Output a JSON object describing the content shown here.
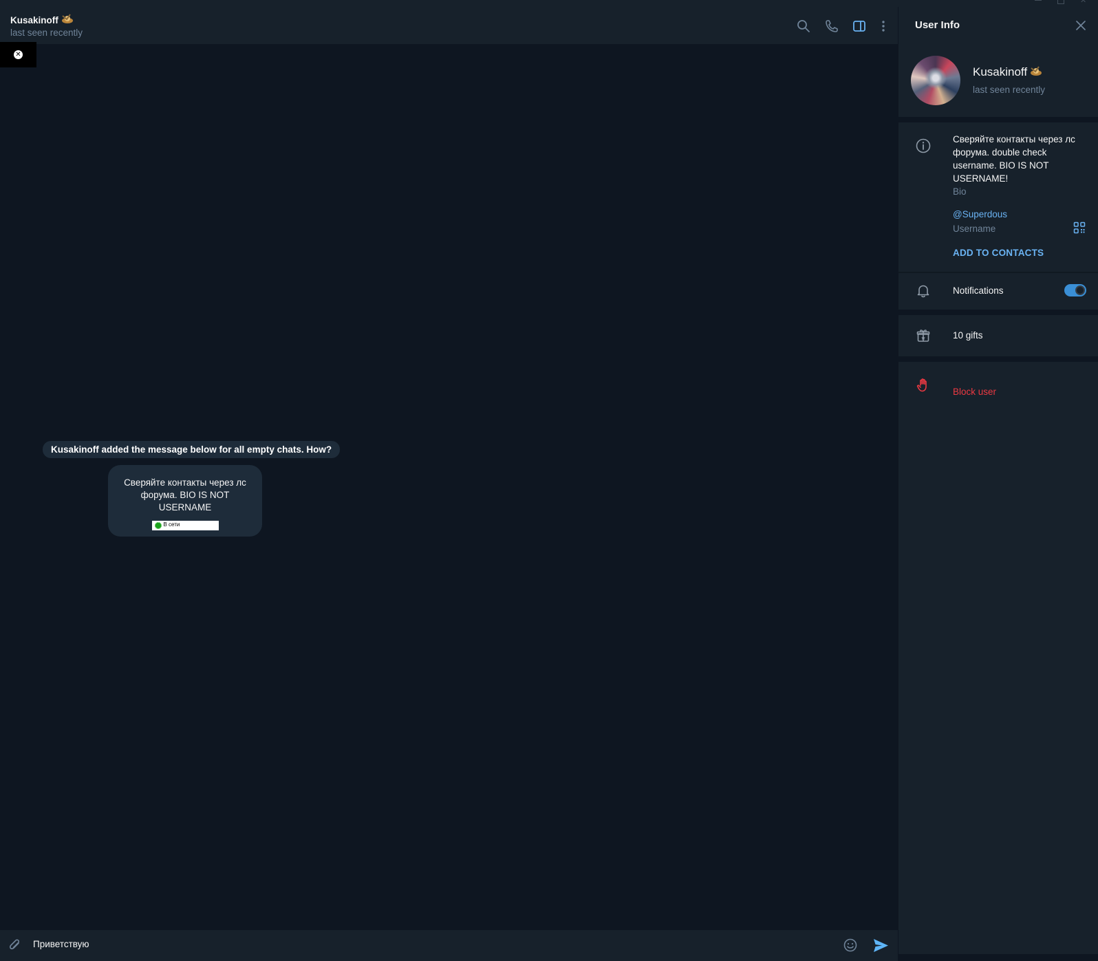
{
  "chat": {
    "title": "Kusakinoff",
    "status": "last seen recently",
    "service_message": "Kusakinoff added the message below for all empty chats. How?",
    "greeting": {
      "text": "Сверяйте контакты через лс форума. BIO IS NOT USERNAME",
      "badge_label": "В сети"
    },
    "composer": {
      "text": "Приветствую"
    },
    "header_icons": [
      "search-icon",
      "phone-icon",
      "sidebar-toggle-icon",
      "more-vertical-icon"
    ]
  },
  "panel": {
    "title": "User Info",
    "name": "Kusakinoff",
    "status": "last seen recently",
    "bio": "Сверяйте контакты через лс форума. double check username. BIO IS NOT USERNAME!",
    "bio_label": "Bio",
    "username": "@Superdous",
    "username_label": "Username",
    "add_contacts": "ADD TO CONTACTS",
    "notifications_label": "Notifications",
    "notifications_on": true,
    "gifts_label": "10 gifts",
    "block_label": "Block user"
  },
  "colors": {
    "background": "#0e1621",
    "surface": "#17212b",
    "bubble": "#1e2c3a",
    "accent": "#6ab3f3",
    "muted": "#708499",
    "danger": "#ec3942",
    "toggle": "#3a8fd6"
  }
}
